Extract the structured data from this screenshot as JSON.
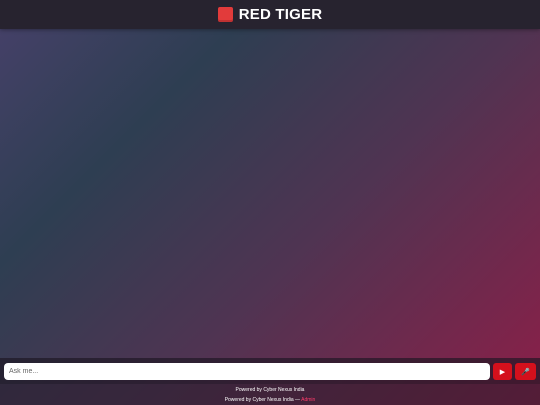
{
  "header": {
    "logo_icon": "red-square-icon",
    "title": "RED TIGER"
  },
  "input": {
    "placeholder": "Ask me...",
    "value": ""
  },
  "buttons": {
    "send_icon": "play-icon",
    "send_glyph": "▶",
    "mic_icon": "microphone-icon",
    "mic_glyph": "🎤",
    "accent_color": "#d4101c"
  },
  "footer": {
    "powered_line": "Powered by Cyber Nexus India",
    "powered_prefix": "Powered by Cyber Nexus India — ",
    "admin_label": "Admin",
    "link_color": "#ff3b6b"
  }
}
